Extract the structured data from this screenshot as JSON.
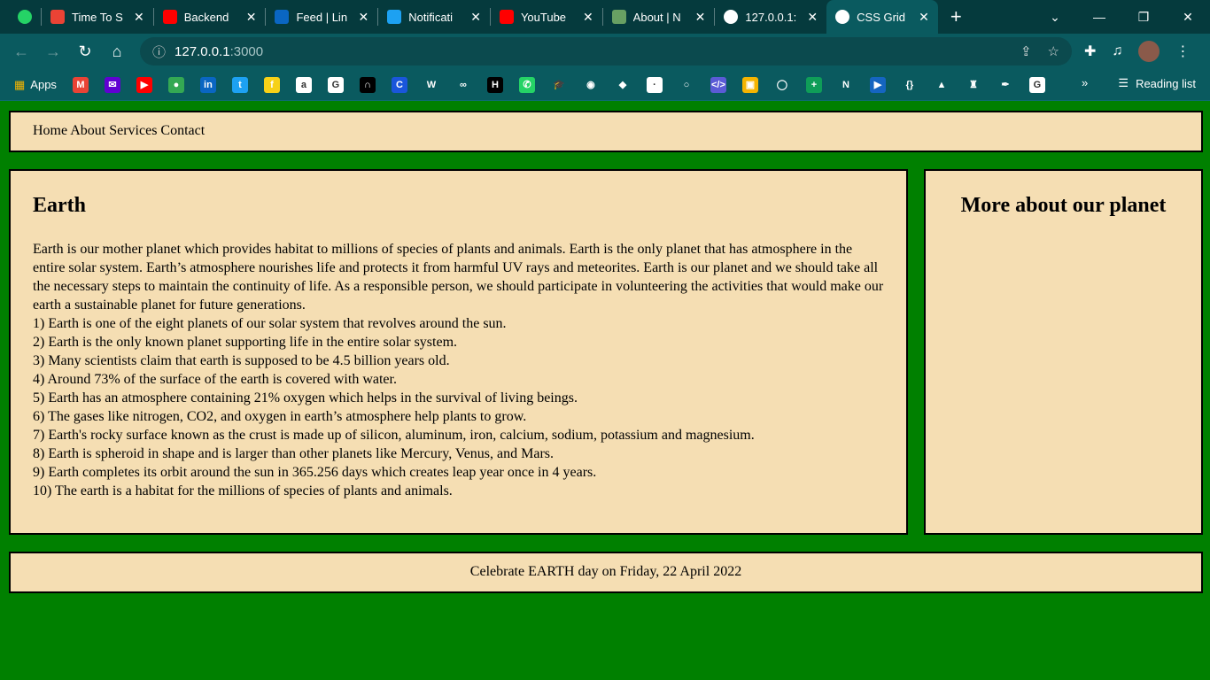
{
  "browser": {
    "tabs": [
      {
        "title": "",
        "icon": "whatsapp-icon",
        "color": "#25d366"
      },
      {
        "title": "Time To S",
        "icon": "gmail-icon",
        "color": "#ea4335"
      },
      {
        "title": "Backend",
        "icon": "youtube-icon",
        "color": "#ff0000"
      },
      {
        "title": "Feed | Lin",
        "icon": "linkedin-icon",
        "color": "#0a66c2"
      },
      {
        "title": "Notificati",
        "icon": "twitter-icon",
        "color": "#1da1f2"
      },
      {
        "title": "YouTube",
        "icon": "youtube-icon",
        "color": "#ff0000"
      },
      {
        "title": "About | N",
        "icon": "nodejs-icon",
        "color": "#68a063"
      },
      {
        "title": "127.0.0.1:",
        "icon": "globe-icon",
        "color": "#ffffff"
      },
      {
        "title": "CSS Grid",
        "icon": "globe-icon",
        "color": "#ffffff",
        "active": true
      }
    ],
    "url_host": "127.0.0.1",
    "url_port": ":3000",
    "apps_label": "Apps",
    "reading_list": "Reading list",
    "bookmarks": [
      {
        "icon": "gmail-icon",
        "color": "#ea4335",
        "glyph": "M"
      },
      {
        "icon": "yahoo-mail-icon",
        "color": "#6001d2",
        "glyph": "✉"
      },
      {
        "icon": "youtube-icon",
        "color": "#ff0000",
        "glyph": "▶"
      },
      {
        "icon": "maps-icon",
        "color": "#34a853",
        "glyph": "●"
      },
      {
        "icon": "linkedin-icon",
        "color": "#0a66c2",
        "glyph": "in"
      },
      {
        "icon": "twitter-icon",
        "color": "#1da1f2",
        "glyph": "t"
      },
      {
        "icon": "flipkart-icon",
        "color": "#f7d117",
        "glyph": "f"
      },
      {
        "icon": "amazon-icon",
        "color": "#ffffff",
        "glyph": "a"
      },
      {
        "icon": "google-icon",
        "color": "#ffffff",
        "glyph": "G"
      },
      {
        "icon": "bookmark-black-icon",
        "color": "#000000",
        "glyph": "∩"
      },
      {
        "icon": "c-icon",
        "color": "#1a56db",
        "glyph": "C"
      },
      {
        "icon": "w-icon",
        "color": "#0a5a5f",
        "glyph": "W"
      },
      {
        "icon": "geeksforgeeks-icon",
        "color": "#0a5a5f",
        "glyph": "∞"
      },
      {
        "icon": "hackerrank-icon",
        "color": "#000000",
        "glyph": "H"
      },
      {
        "icon": "whatsapp-icon",
        "color": "#25d366",
        "glyph": "✆"
      },
      {
        "icon": "graduation-cap-icon",
        "color": "#0a5a5f",
        "glyph": "🎓"
      },
      {
        "icon": "github-icon",
        "color": "#0a5a5f",
        "glyph": "◉"
      },
      {
        "icon": "diamond-icon",
        "color": "#0a5a5f",
        "glyph": "◆"
      },
      {
        "icon": "page-icon",
        "color": "#ffffff",
        "glyph": "·"
      },
      {
        "icon": "circle-dashed-icon",
        "color": "#0a5a5f",
        "glyph": "○"
      },
      {
        "icon": "code-icon",
        "color": "#5b5bd6",
        "glyph": "</>"
      },
      {
        "icon": "classroom-icon",
        "color": "#f4b400",
        "glyph": "▣"
      },
      {
        "icon": "circle-icon",
        "color": "#0a5a5f",
        "glyph": "◯"
      },
      {
        "icon": "plus-icon",
        "color": "#0f9d58",
        "glyph": "+"
      },
      {
        "icon": "netflix-icon",
        "color": "#0a5a5f",
        "glyph": "N"
      },
      {
        "icon": "play-icon",
        "color": "#1565c0",
        "glyph": "▶"
      },
      {
        "icon": "brackets-icon",
        "color": "#0a5a5f",
        "glyph": "{}"
      },
      {
        "icon": "google-drive-icon",
        "color": "#0a5a5f",
        "glyph": "▲"
      },
      {
        "icon": "figure-icon",
        "color": "#0a5a5f",
        "glyph": "♜"
      },
      {
        "icon": "pen-icon",
        "color": "#0a5a5f",
        "glyph": "✒"
      },
      {
        "icon": "google-icon",
        "color": "#ffffff",
        "glyph": "G"
      }
    ]
  },
  "page": {
    "nav": "Home About Services Contact",
    "main": {
      "title": "Earth",
      "intro": "Earth is our mother planet which provides habitat to millions of species of plants and animals. Earth is the only planet that has atmosphere in the entire solar system. Earth’s atmosphere nourishes life and protects it from harmful UV rays and meteorites. Earth is our planet and we should take all the necessary steps to maintain the continuity of life. As a responsible person, we should participate in volunteering the activities that would make our earth a sustainable planet for future generations.",
      "facts": [
        "1) Earth is one of the eight planets of our solar system that revolves around the sun.",
        "2) Earth is the only known planet supporting life in the entire solar system.",
        "3) Many scientists claim that earth is supposed to be 4.5 billion years old.",
        "4) Around 73% of the surface of the earth is covered with water.",
        "5) Earth has an atmosphere containing 21% oxygen which helps in the survival of living beings.",
        "6) The gases like nitrogen, CO2, and oxygen in earth’s atmosphere help plants to grow.",
        "7) Earth's rocky surface known as the crust is made up of silicon, aluminum, iron, calcium, sodium, potassium and magnesium.",
        "8) Earth is spheroid in shape and is larger than other planets like Mercury, Venus, and Mars.",
        "9) Earth completes its orbit around the sun in 365.256 days which creates leap year once in 4 years.",
        "10) The earth is a habitat for the millions of species of plants and animals."
      ]
    },
    "aside_title": "More about our planet",
    "footer": "Celebrate EARTH day on Friday, 22 April 2022"
  }
}
